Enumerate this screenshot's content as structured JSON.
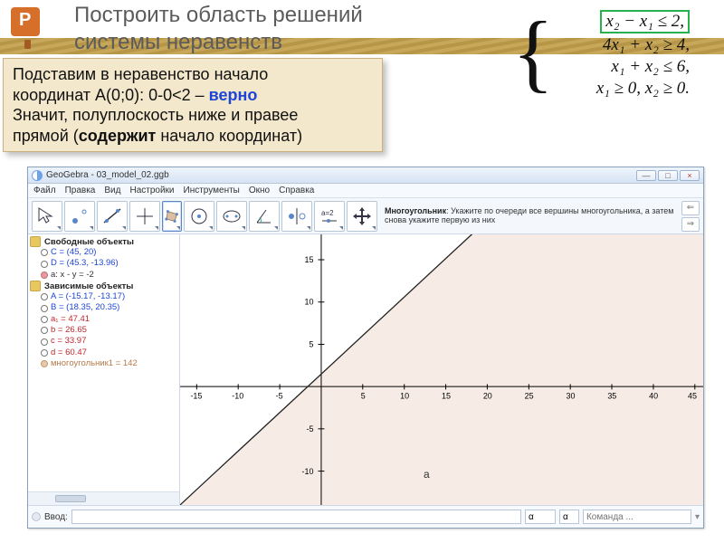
{
  "slide": {
    "icon_letter": "P",
    "title_line1": "Построить область решений",
    "title_line2": "системы неравенств"
  },
  "explanation": {
    "line1_a": "Подставим в неравенство начало",
    "line1_b": "координат A(0;0): 0-0<2 – ",
    "line1_c": "верно",
    "line2": "Значит, полуплоскость ниже и правее",
    "line3_a": "прямой (",
    "line3_b": "содержит",
    "line3_c": " начало координат)"
  },
  "formula": {
    "eq1": "x₂ − x₁ ≤ 2,",
    "eq2": "4x₁ + x₂ ≥ 4,",
    "eq3": "x₁ + x₂ ≤ 6,",
    "eq4": "x₁ ≥ 0, x₂ ≥ 0."
  },
  "app": {
    "title": "GeoGebra - 03_model_02.ggb",
    "window_buttons": {
      "min": "—",
      "max": "□",
      "close": "×"
    },
    "menu": [
      "Файл",
      "Правка",
      "Вид",
      "Настройки",
      "Инструменты",
      "Окно",
      "Справка"
    ],
    "toolbar_tip": {
      "head": "Многоугольник",
      "body": ": Укажите по очереди все вершины многоугольника, а затем снова укажите первую из них"
    },
    "nav": {
      "back": "⇐",
      "fwd": "⇒"
    },
    "sidebar": {
      "group_free": "Свободные объекты",
      "free": [
        {
          "label": "C = (45, 20)",
          "color": "#1d45d6"
        },
        {
          "label": "D = (45.3, -13.96)",
          "color": "#1d45d6"
        },
        {
          "label": "a: x - y = -2",
          "color": "#333",
          "filled": true
        }
      ],
      "group_dep": "Зависимые объекты",
      "dep": [
        {
          "label": "A = (-15.17, -13.17)",
          "color": "#1d45d6"
        },
        {
          "label": "B = (18.35, 20.35)",
          "color": "#1d45d6"
        },
        {
          "label": "a₁ = 47.41",
          "color": "#c1272d"
        },
        {
          "label": "b = 26.65",
          "color": "#c1272d"
        },
        {
          "label": "c = 33.97",
          "color": "#c1272d"
        },
        {
          "label": "d = 60.47",
          "color": "#c1272d"
        },
        {
          "label": "многоугольник1 = 142",
          "color": "#b57a4a",
          "filled": true
        }
      ]
    },
    "input": {
      "label": "Ввод:",
      "main_value": "",
      "small_value": "α",
      "sel_value": "α",
      "cmd_placeholder": "Команда ..."
    }
  },
  "chart_data": {
    "type": "line",
    "title": "",
    "xlabel": "",
    "ylabel": "",
    "xlim": [
      -17,
      46
    ],
    "ylim": [
      -14,
      18
    ],
    "x_ticks": [
      -15,
      -10,
      -5,
      5,
      10,
      15,
      20,
      25,
      30,
      35,
      40,
      45
    ],
    "y_ticks": [
      -10,
      -5,
      5,
      10,
      15
    ],
    "lines": [
      {
        "name": "a",
        "x": [
          -15,
          18
        ],
        "y": [
          -13,
          20
        ]
      }
    ],
    "shaded_region": {
      "description": "полуплоскость x-y ≤ -2 (ниже и правее прямой a)",
      "color": "#f7ece5"
    },
    "line_label": "a"
  }
}
